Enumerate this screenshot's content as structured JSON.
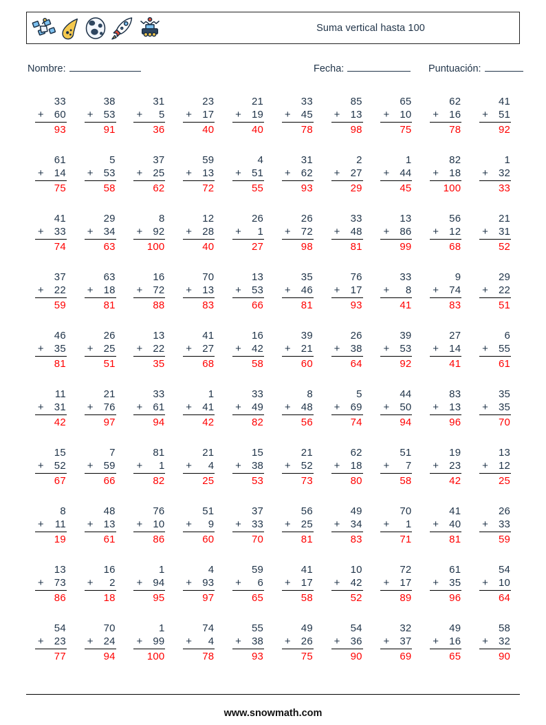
{
  "header": {
    "title": "Suma vertical hasta 100",
    "icons": [
      "satellite-icon",
      "comet-icon",
      "moon-icon",
      "rocket-icon",
      "rover-icon"
    ]
  },
  "meta": {
    "name_label": "Nombre:",
    "name_value": "",
    "date_label": "Fecha:",
    "date_value": "",
    "score_label": "Puntuación:",
    "score_value": ""
  },
  "colors": {
    "number": "#1f3348",
    "answer": "#ff0000",
    "rule": "#000000",
    "border": "#222222"
  },
  "operator": "+",
  "footer": {
    "url": "www.snowmath.com"
  },
  "problems": [
    [
      {
        "a": "33",
        "b": "60",
        "sum": "93"
      },
      {
        "a": "38",
        "b": "53",
        "sum": "91"
      },
      {
        "a": "31",
        "b": "5",
        "sum": "36"
      },
      {
        "a": "23",
        "b": "17",
        "sum": "40"
      },
      {
        "a": "21",
        "b": "19",
        "sum": "40"
      },
      {
        "a": "33",
        "b": "45",
        "sum": "78"
      },
      {
        "a": "85",
        "b": "13",
        "sum": "98"
      },
      {
        "a": "65",
        "b": "10",
        "sum": "75"
      },
      {
        "a": "62",
        "b": "16",
        "sum": "78"
      },
      {
        "a": "41",
        "b": "51",
        "sum": "92"
      }
    ],
    [
      {
        "a": "61",
        "b": "14",
        "sum": "75"
      },
      {
        "a": "5",
        "b": "53",
        "sum": "58"
      },
      {
        "a": "37",
        "b": "25",
        "sum": "62"
      },
      {
        "a": "59",
        "b": "13",
        "sum": "72"
      },
      {
        "a": "4",
        "b": "51",
        "sum": "55"
      },
      {
        "a": "31",
        "b": "62",
        "sum": "93"
      },
      {
        "a": "2",
        "b": "27",
        "sum": "29"
      },
      {
        "a": "1",
        "b": "44",
        "sum": "45"
      },
      {
        "a": "82",
        "b": "18",
        "sum": "100"
      },
      {
        "a": "1",
        "b": "32",
        "sum": "33"
      }
    ],
    [
      {
        "a": "41",
        "b": "33",
        "sum": "74"
      },
      {
        "a": "29",
        "b": "34",
        "sum": "63"
      },
      {
        "a": "8",
        "b": "92",
        "sum": "100"
      },
      {
        "a": "12",
        "b": "28",
        "sum": "40"
      },
      {
        "a": "26",
        "b": "1",
        "sum": "27"
      },
      {
        "a": "26",
        "b": "72",
        "sum": "98"
      },
      {
        "a": "33",
        "b": "48",
        "sum": "81"
      },
      {
        "a": "13",
        "b": "86",
        "sum": "99"
      },
      {
        "a": "56",
        "b": "12",
        "sum": "68"
      },
      {
        "a": "21",
        "b": "31",
        "sum": "52"
      }
    ],
    [
      {
        "a": "37",
        "b": "22",
        "sum": "59"
      },
      {
        "a": "63",
        "b": "18",
        "sum": "81"
      },
      {
        "a": "16",
        "b": "72",
        "sum": "88"
      },
      {
        "a": "70",
        "b": "13",
        "sum": "83"
      },
      {
        "a": "13",
        "b": "53",
        "sum": "66"
      },
      {
        "a": "35",
        "b": "46",
        "sum": "81"
      },
      {
        "a": "76",
        "b": "17",
        "sum": "93"
      },
      {
        "a": "33",
        "b": "8",
        "sum": "41"
      },
      {
        "a": "9",
        "b": "74",
        "sum": "83"
      },
      {
        "a": "29",
        "b": "22",
        "sum": "51"
      }
    ],
    [
      {
        "a": "46",
        "b": "35",
        "sum": "81"
      },
      {
        "a": "26",
        "b": "25",
        "sum": "51"
      },
      {
        "a": "13",
        "b": "22",
        "sum": "35"
      },
      {
        "a": "41",
        "b": "27",
        "sum": "68"
      },
      {
        "a": "16",
        "b": "42",
        "sum": "58"
      },
      {
        "a": "39",
        "b": "21",
        "sum": "60"
      },
      {
        "a": "26",
        "b": "38",
        "sum": "64"
      },
      {
        "a": "39",
        "b": "53",
        "sum": "92"
      },
      {
        "a": "27",
        "b": "14",
        "sum": "41"
      },
      {
        "a": "6",
        "b": "55",
        "sum": "61"
      }
    ],
    [
      {
        "a": "11",
        "b": "31",
        "sum": "42"
      },
      {
        "a": "21",
        "b": "76",
        "sum": "97"
      },
      {
        "a": "33",
        "b": "61",
        "sum": "94"
      },
      {
        "a": "1",
        "b": "41",
        "sum": "42"
      },
      {
        "a": "33",
        "b": "49",
        "sum": "82"
      },
      {
        "a": "8",
        "b": "48",
        "sum": "56"
      },
      {
        "a": "5",
        "b": "69",
        "sum": "74"
      },
      {
        "a": "44",
        "b": "50",
        "sum": "94"
      },
      {
        "a": "83",
        "b": "13",
        "sum": "96"
      },
      {
        "a": "35",
        "b": "35",
        "sum": "70"
      }
    ],
    [
      {
        "a": "15",
        "b": "52",
        "sum": "67"
      },
      {
        "a": "7",
        "b": "59",
        "sum": "66"
      },
      {
        "a": "81",
        "b": "1",
        "sum": "82"
      },
      {
        "a": "21",
        "b": "4",
        "sum": "25"
      },
      {
        "a": "15",
        "b": "38",
        "sum": "53"
      },
      {
        "a": "21",
        "b": "52",
        "sum": "73"
      },
      {
        "a": "62",
        "b": "18",
        "sum": "80"
      },
      {
        "a": "51",
        "b": "7",
        "sum": "58"
      },
      {
        "a": "19",
        "b": "23",
        "sum": "42"
      },
      {
        "a": "13",
        "b": "12",
        "sum": "25"
      }
    ],
    [
      {
        "a": "8",
        "b": "11",
        "sum": "19"
      },
      {
        "a": "48",
        "b": "13",
        "sum": "61"
      },
      {
        "a": "76",
        "b": "10",
        "sum": "86"
      },
      {
        "a": "51",
        "b": "9",
        "sum": "60"
      },
      {
        "a": "37",
        "b": "33",
        "sum": "70"
      },
      {
        "a": "56",
        "b": "25",
        "sum": "81"
      },
      {
        "a": "49",
        "b": "34",
        "sum": "83"
      },
      {
        "a": "70",
        "b": "1",
        "sum": "71"
      },
      {
        "a": "41",
        "b": "40",
        "sum": "81"
      },
      {
        "a": "26",
        "b": "33",
        "sum": "59"
      }
    ],
    [
      {
        "a": "13",
        "b": "73",
        "sum": "86"
      },
      {
        "a": "16",
        "b": "2",
        "sum": "18"
      },
      {
        "a": "1",
        "b": "94",
        "sum": "95"
      },
      {
        "a": "4",
        "b": "93",
        "sum": "97"
      },
      {
        "a": "59",
        "b": "6",
        "sum": "65"
      },
      {
        "a": "41",
        "b": "17",
        "sum": "58"
      },
      {
        "a": "10",
        "b": "42",
        "sum": "52"
      },
      {
        "a": "72",
        "b": "17",
        "sum": "89"
      },
      {
        "a": "61",
        "b": "35",
        "sum": "96"
      },
      {
        "a": "54",
        "b": "10",
        "sum": "64"
      }
    ],
    [
      {
        "a": "54",
        "b": "23",
        "sum": "77"
      },
      {
        "a": "70",
        "b": "24",
        "sum": "94"
      },
      {
        "a": "1",
        "b": "99",
        "sum": "100"
      },
      {
        "a": "74",
        "b": "4",
        "sum": "78"
      },
      {
        "a": "55",
        "b": "38",
        "sum": "93"
      },
      {
        "a": "49",
        "b": "26",
        "sum": "75"
      },
      {
        "a": "54",
        "b": "36",
        "sum": "90"
      },
      {
        "a": "32",
        "b": "37",
        "sum": "69"
      },
      {
        "a": "49",
        "b": "16",
        "sum": "65"
      },
      {
        "a": "58",
        "b": "32",
        "sum": "90"
      }
    ]
  ]
}
